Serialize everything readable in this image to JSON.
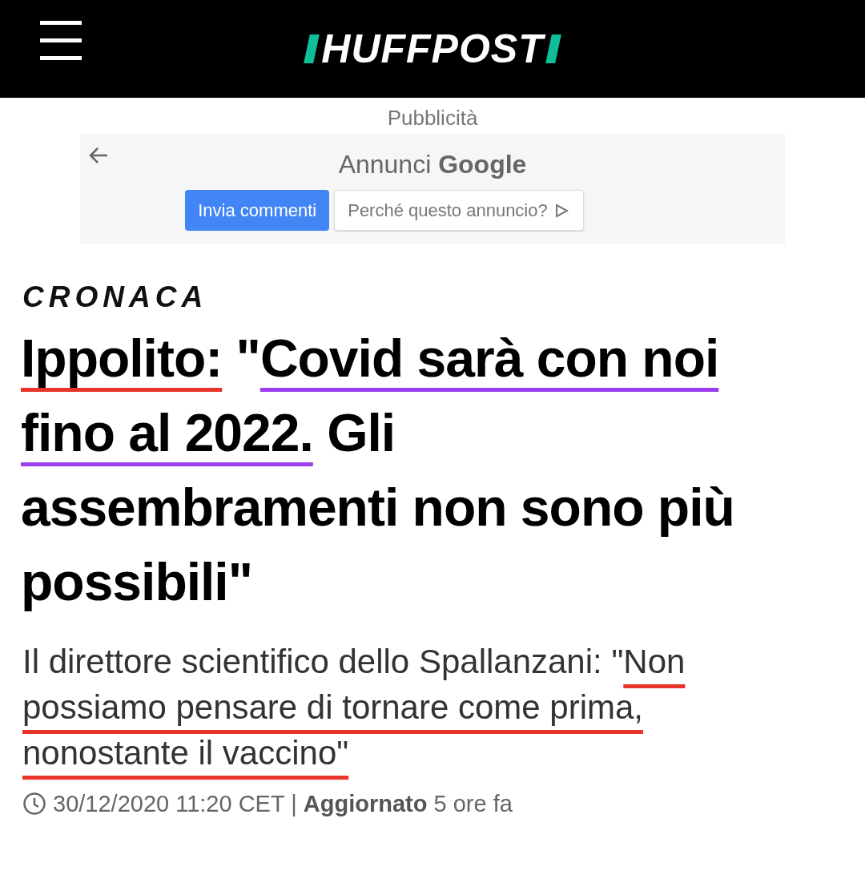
{
  "header": {
    "logo": "HUFFPOST"
  },
  "ad": {
    "label": "Pubblicità",
    "title": "Annunci",
    "brand": "Google",
    "buttons": [
      {
        "label": "Invia commenti",
        "kind": "primary"
      },
      {
        "label": "Perché questo annuncio?",
        "kind": "outline"
      }
    ]
  },
  "article": {
    "section": "CRONACA",
    "headline": [
      {
        "text": "Ippolito:",
        "color": "#e8342a"
      },
      {
        "text": " \""
      },
      {
        "text": "Covid sarà con noi fino al 2022.",
        "color": "#9b3ff0"
      },
      {
        "text": " Gli assembramenti non sono più possibili\""
      }
    ],
    "subtitle": [
      {
        "text": "Il direttore scientifico dello Spallanzani: \""
      },
      {
        "text": "Non possiamo pensare di tornare come prima, nonostante il vaccino\"",
        "color": "#e8342a"
      }
    ],
    "meta": "30/12/2020 11:20 CET | **Aggiornato** 5 ore fa"
  }
}
